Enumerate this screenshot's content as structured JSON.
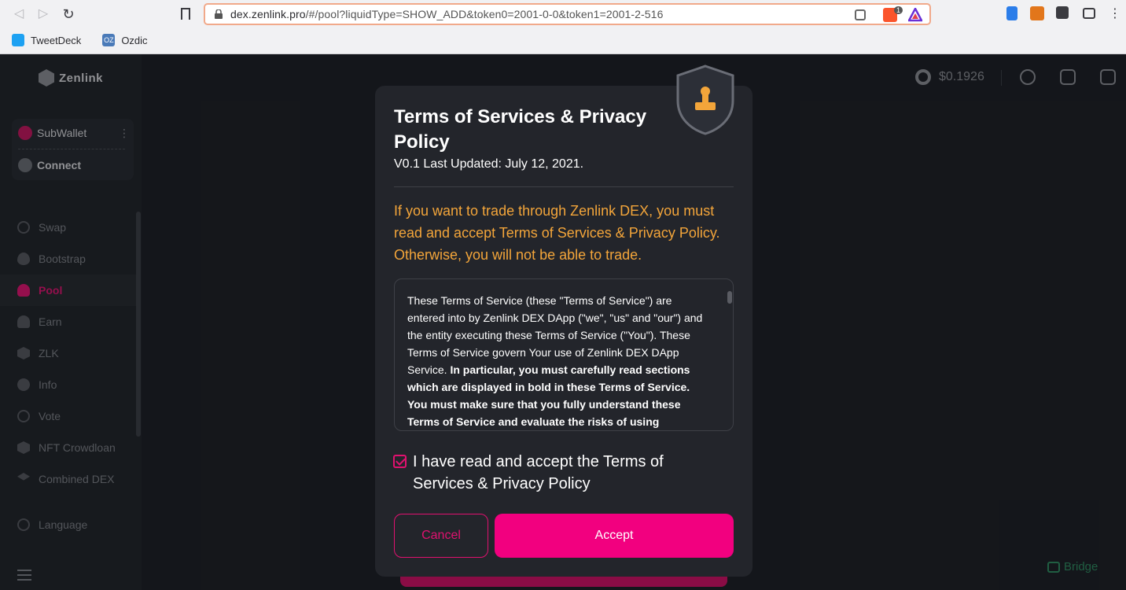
{
  "browser": {
    "url_host": "dex.zenlink.pro",
    "url_path": "/#/pool?liquidType=SHOW_ADD&token0=2001-0-0&token1=2001-2-516",
    "bookmarks": [
      "TweetDeck",
      "Ozdic"
    ],
    "brave_badge": "1"
  },
  "app": {
    "logo_text": "Zenlink",
    "wallet": {
      "name": "SubWallet",
      "connect_label": "Connect"
    },
    "menu": [
      {
        "label": "Swap",
        "icon": "swap-icon"
      },
      {
        "label": "Bootstrap",
        "icon": "flame-icon"
      },
      {
        "label": "Pool",
        "icon": "pool-icon",
        "active": true
      },
      {
        "label": "Earn",
        "icon": "earn-icon"
      },
      {
        "label": "ZLK",
        "icon": "zlk-icon"
      },
      {
        "label": "Info",
        "icon": "chart-icon"
      },
      {
        "label": "Vote",
        "icon": "vote-icon"
      },
      {
        "label": "NFT Crowdloan",
        "icon": "cube-icon"
      },
      {
        "label": "Combined DEX",
        "icon": "layers-icon"
      }
    ],
    "language_label": "Language",
    "price": "$0.1926",
    "bridge_label": "Bridge",
    "colors": {
      "accent": "#f2007f",
      "warning": "#f3a53a",
      "bridge": "#2d8a5f"
    }
  },
  "modal": {
    "title": "Terms of Services & Privacy Policy",
    "version": "V0.1 Last Updated: July 12, 2021.",
    "warning": "If you want to trade through Zenlink DEX, you must read and accept Terms of Services & Privacy Policy. Otherwise, you will not be able to trade.",
    "terms_plain": "These Terms of Service (these \"Terms of Service\") are entered into by Zenlink DEX DApp (\"we\", \"us\" and \"our\") and the entity executing these Terms of Service (\"You\"). These Terms of Service govern Your use of Zenlink DEX DApp Service. ",
    "terms_bold": "In particular, you must carefully read sections which are displayed in bold in these Terms of Service. You must make sure that you fully understand these Terms of Service and evaluate the risks of using",
    "checkbox_label": "I have read and accept the Terms of Services & Privacy Policy",
    "checkbox_checked": true,
    "cancel_label": "Cancel",
    "accept_label": "Accept"
  }
}
